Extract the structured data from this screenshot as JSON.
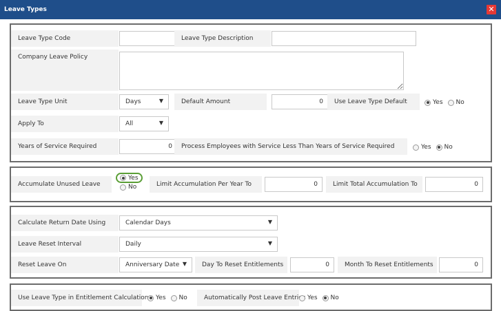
{
  "window": {
    "title": "Leave Types",
    "close_glyph": "✕"
  },
  "section1": {
    "leave_type_code_label": "Leave Type Code",
    "leave_type_code_value": "",
    "leave_type_description_label": "Leave Type Description",
    "leave_type_description_value": "",
    "company_leave_policy_label": "Company Leave Policy",
    "company_leave_policy_value": "",
    "leave_type_unit_label": "Leave Type Unit",
    "leave_type_unit_value": "Days",
    "default_amount_label": "Default Amount",
    "default_amount_value": "0",
    "use_leave_type_default_label": "Use Leave Type Default",
    "use_leave_type_default_selected": "Yes",
    "apply_to_label": "Apply To",
    "apply_to_value": "All",
    "years_of_service_label": "Years of Service Required",
    "years_of_service_value": "0",
    "process_employees_label": "Process Employees with Service Less Than Years of Service Required",
    "process_employees_selected": "No",
    "yes": "Yes",
    "no": "No"
  },
  "section2": {
    "accumulate_label": "Accumulate Unused Leave",
    "accumulate_selected": "Yes",
    "limit_per_year_label": "Limit Accumulation Per Year To",
    "limit_per_year_value": "0",
    "limit_total_label": "Limit Total Accumulation To",
    "limit_total_value": "0",
    "yes": "Yes",
    "no": "No"
  },
  "section3": {
    "calc_return_label": "Calculate Return Date Using",
    "calc_return_value": "Calendar Days",
    "reset_interval_label": "Leave Reset Interval",
    "reset_interval_value": "Daily",
    "reset_on_label": "Reset Leave On",
    "reset_on_value": "Anniversary Date",
    "day_to_reset_label": "Day To Reset Entitlements",
    "day_to_reset_value": "0",
    "month_to_reset_label": "Month To Reset Entitlements",
    "month_to_reset_value": "0"
  },
  "section4": {
    "use_in_entitlement_label": "Use Leave Type in Entitlement Calculation",
    "use_in_entitlement_selected": "Yes",
    "auto_post_label": "Automatically Post Leave Entries",
    "auto_post_selected": "No",
    "yes": "Yes",
    "no": "No"
  },
  "icons": {
    "dropdown": "chevron-down-icon",
    "close": "close-icon"
  },
  "colors": {
    "titlebar": "#1f4e8a",
    "close": "#e53935",
    "highlight": "#5a9e35"
  }
}
